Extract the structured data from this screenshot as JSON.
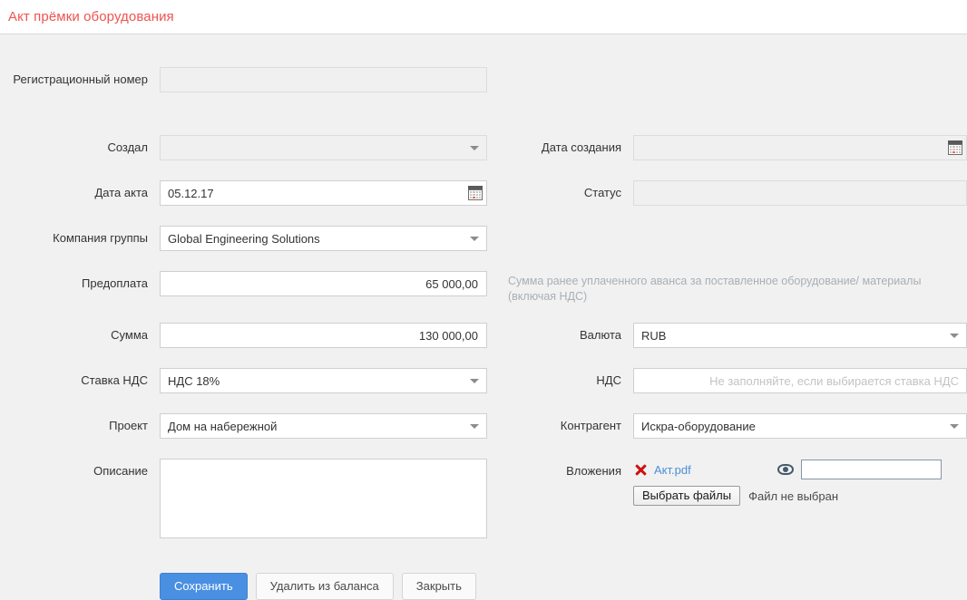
{
  "header": {
    "title": "Акт прёмки оборудования"
  },
  "form": {
    "reg_number": {
      "label": "Регистрационный номер",
      "value": "",
      "placeholder": ""
    },
    "created_by": {
      "label": "Создал",
      "value": "",
      "icon": "chevron-down-icon"
    },
    "created_date": {
      "label": "Дата создания",
      "value": "",
      "icon": "calendar-icon"
    },
    "act_date": {
      "label": "Дата акта",
      "value": "05.12.17",
      "icon": "calendar-icon"
    },
    "status": {
      "label": "Статус",
      "value": ""
    },
    "group_company": {
      "label": "Компания группы",
      "value": "Global Engineering Solutions",
      "icon": "chevron-down-icon"
    },
    "prepayment": {
      "label": "Предоплата",
      "value": "65 000,00"
    },
    "prepayment_hint": "Сумма ранее уплаченного аванса за поставленное оборудование/ материалы (включая НДС)",
    "amount": {
      "label": "Сумма",
      "value": "130 000,00"
    },
    "currency": {
      "label": "Валюта",
      "value": "RUB",
      "icon": "chevron-down-icon"
    },
    "vat_rate": {
      "label": "Ставка НДС",
      "value": "НДС 18%",
      "icon": "chevron-down-icon"
    },
    "vat": {
      "label": "НДС",
      "value": "",
      "placeholder": "Не заполняйте, если выбирается ставка НДС"
    },
    "project": {
      "label": "Проект",
      "value": "Дом на набережной",
      "icon": "chevron-down-icon"
    },
    "counterparty": {
      "label": "Контрагент",
      "value": "Искра-оборудование",
      "icon": "chevron-down-icon"
    },
    "description": {
      "label": "Описание",
      "value": ""
    },
    "attachments": {
      "label": "Вложения",
      "delete_icon": "delete-x-icon",
      "file_name": "Акт.pdf",
      "preview_icon": "eye-icon",
      "comment_value": "",
      "choose_files_label": "Выбрать файлы",
      "file_status": "Файл не выбран"
    }
  },
  "buttons": {
    "save": "Сохранить",
    "remove_from_balance": "Удалить из баланса",
    "close": "Закрыть"
  },
  "colors": {
    "title": "#ef5350",
    "primary_button": "#4a90e2",
    "link": "#4a90d9",
    "delete_icon": "#cc1111",
    "page_background": "#f1f1f1",
    "hint_text": "#a9afb6"
  }
}
